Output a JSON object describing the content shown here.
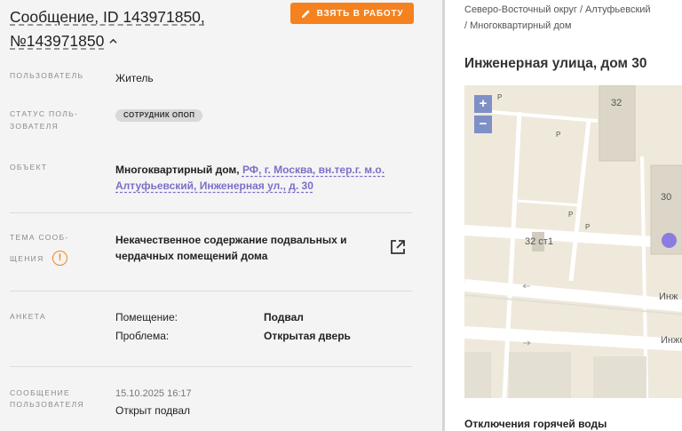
{
  "message": {
    "title_line1": "Сообщение, ID 143971850,",
    "title_line2": "№143971850",
    "take_button_label": "ВЗЯТЬ В РАБОТУ"
  },
  "fields": {
    "user": {
      "label": "ПОЛЬЗОВАТЕЛЬ",
      "value": "Житель"
    },
    "user_status": {
      "label_line1": "СТАТУС ПОЛЬ-",
      "label_line2": "ЗОВАТЕЛЯ",
      "badge": "СОТРУДНИК ОПОП"
    },
    "object": {
      "label": "ОБЪЕКТ",
      "prefix": "Многоквартирный дом,",
      "link_line1": "РФ, г. Москва, вн.тер.г. м.о.",
      "link_line2": "Алтуфьевский, Инженерная ул., д. 30"
    },
    "topic": {
      "label_line1": "ТЕМА СООБ-",
      "label_line2": "ЩЕНИЯ",
      "value_line1": "Некачественное содержание подвальных и",
      "value_line2": "чердачных помещений дома"
    },
    "survey": {
      "label": "АНКЕТА",
      "rows": [
        {
          "key": "Помещение:",
          "value": "Подвал"
        },
        {
          "key": "Проблема:",
          "value": "Открытая дверь"
        }
      ]
    },
    "user_message": {
      "label_line1": "СООБЩЕНИЕ",
      "label_line2": "ПОЛЬЗОВАТЕЛЯ",
      "timestamp": "15.10.2025 16:17",
      "text": "Открыт подвал"
    }
  },
  "location": {
    "breadcrumb_line1": "Северо-Восточный округ / Алтуфьевский",
    "breadcrumb_line2": "/ Многоквартирный дом",
    "address": "Инженерная улица, дом 30",
    "map": {
      "zoom_in": "+",
      "zoom_out": "−",
      "building_32": "32",
      "building_30": "30",
      "building_32s1": "32 ст1",
      "street_1": "Инж",
      "street_2": "Инже",
      "parking": "P"
    },
    "section_title": "Отключения горячей воды"
  },
  "colors": {
    "accent_orange": "#f5821f",
    "link_purple": "#7c6fc9",
    "marker": "#8c7be0"
  }
}
